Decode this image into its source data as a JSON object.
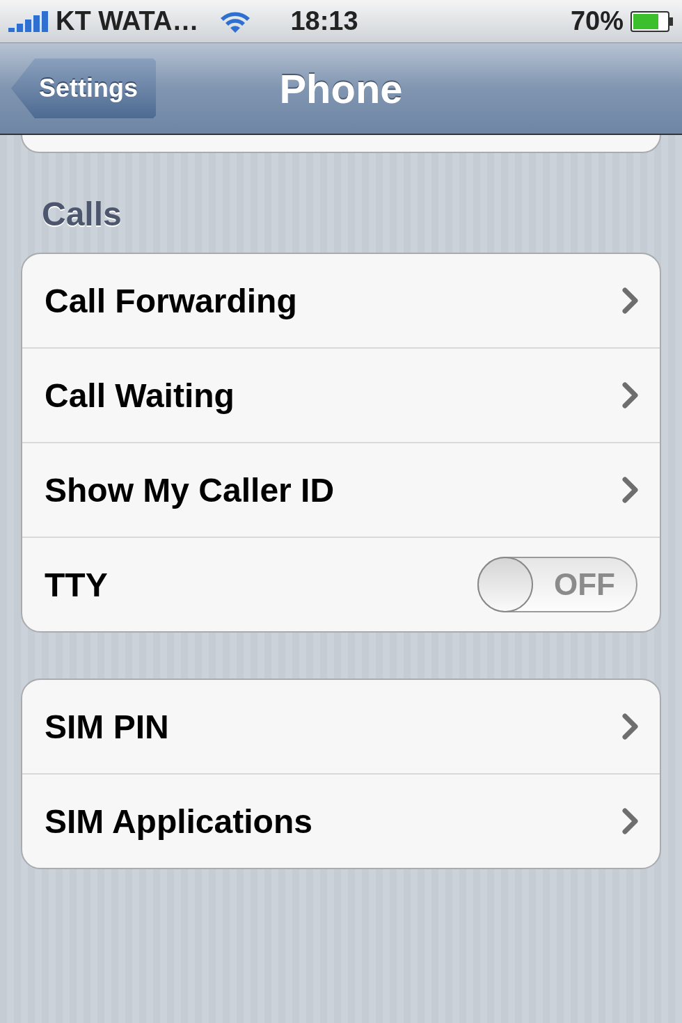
{
  "status_bar": {
    "carrier": "KT WATA…",
    "time": "18:13",
    "battery": "70%"
  },
  "nav_bar": {
    "back": "Settings",
    "title": "Phone"
  },
  "sections": [
    {
      "header": "Calls",
      "rows": [
        {
          "kind": "link",
          "label": "Call Forwarding"
        },
        {
          "kind": "link",
          "label": "Call Waiting"
        },
        {
          "kind": "link",
          "label": "Show My Caller ID"
        },
        {
          "kind": "switch",
          "label": "TTY",
          "on": false,
          "state_label": "OFF"
        }
      ]
    },
    {
      "rows": [
        {
          "kind": "link",
          "label": "SIM PIN"
        },
        {
          "kind": "link",
          "label": "SIM Applications"
        }
      ]
    }
  ]
}
